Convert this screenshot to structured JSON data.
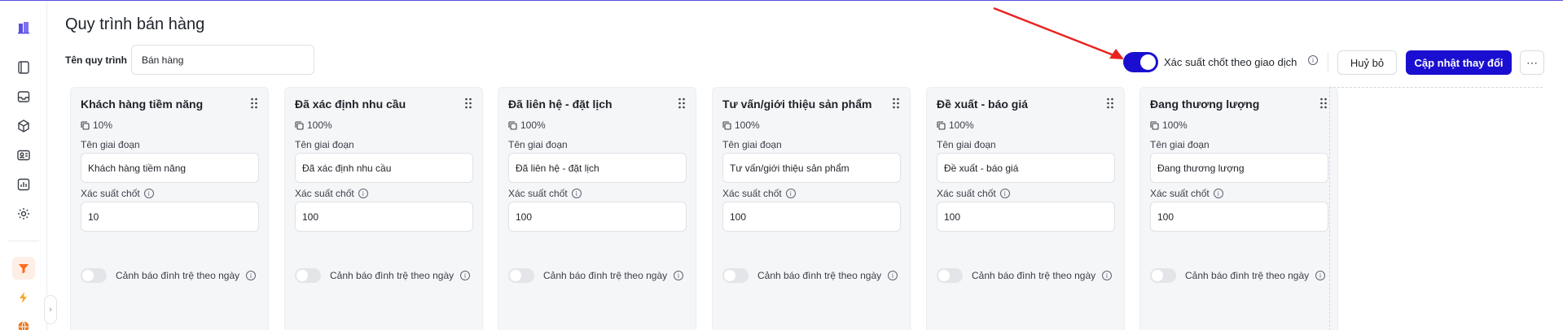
{
  "page": {
    "title": "Quy trình bán hàng",
    "name_label": "Tên quy trình",
    "name_value": "Bán hàng"
  },
  "header": {
    "probability_toggle_on": true,
    "probability_label": "Xác suất chốt theo giao dịch",
    "cancel_label": "Huỷ bỏ",
    "update_label": "Cập nhật thay đổi",
    "more_label": "⋯"
  },
  "colors": {
    "accent": "#1a0fd0",
    "annotation_arrow": "#e8231f",
    "active_sidebar_icon": "#ff6a1a"
  },
  "sidebar": {
    "items": [
      {
        "icon": "building-icon"
      },
      {
        "icon": "book-icon"
      },
      {
        "icon": "inbox-icon"
      },
      {
        "icon": "cube-icon"
      },
      {
        "icon": "contact-card-icon"
      },
      {
        "icon": "bar-chart-icon"
      },
      {
        "icon": "gear-icon"
      },
      {
        "icon": "funnel-icon",
        "active": true
      },
      {
        "icon": "lightning-icon"
      },
      {
        "icon": "globe-icon"
      }
    ],
    "expand_label": "›"
  },
  "stage_labels": {
    "name_label": "Tên giai đoạn",
    "probability_label": "Xác suất chốt",
    "warning_label": "Cảnh báo đình trệ theo ngày"
  },
  "stages": [
    {
      "title": "Khách hàng tiềm năng",
      "percent": "10%",
      "name": "Khách hàng tiềm năng",
      "probability": "10"
    },
    {
      "title": "Đã xác định nhu cầu",
      "percent": "100%",
      "name": "Đã xác định nhu cầu",
      "probability": "100"
    },
    {
      "title": "Đã liên hệ - đặt lịch",
      "percent": "100%",
      "name": "Đã liên hệ - đặt lịch",
      "probability": "100"
    },
    {
      "title": "Tư vấn/giới thiệu sản phẩm",
      "percent": "100%",
      "name": "Tư vấn/giới thiệu sản phẩm",
      "probability": "100"
    },
    {
      "title": "Đề xuất - báo giá",
      "percent": "100%",
      "name": "Đề xuất - báo giá",
      "probability": "100"
    },
    {
      "title": "Đang thương lượng",
      "percent": "100%",
      "name": "Đang thương lượng",
      "probability": "100"
    }
  ]
}
